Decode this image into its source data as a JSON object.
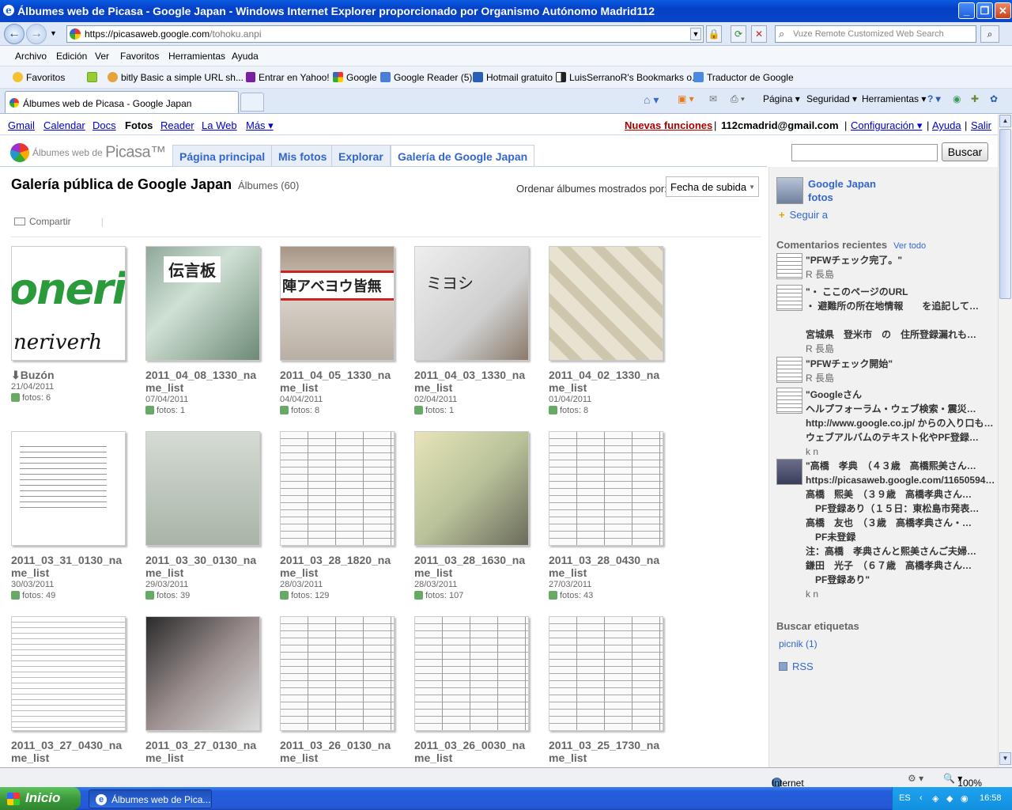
{
  "window": {
    "title": "Álbumes web de Picasa - Google Japan - Windows Internet Explorer proporcionado por Organismo Autónomo Madrid112"
  },
  "address": {
    "url_prefix": "https://",
    "url_domain": "picasaweb.google.com",
    "url_path": "/tohoku.anpi",
    "search_placeholder": "Vuze Remote Customized Web Search"
  },
  "menu": [
    "Archivo",
    "Edición",
    "Ver",
    "Favoritos",
    "Herramientas",
    "Ayuda"
  ],
  "favorites": {
    "label": "Favoritos",
    "items": [
      "bitly  Basic  a simple URL sh...",
      "Entrar en Yahoo!",
      "Google",
      "Google Reader (5)",
      "Hotmail gratuito",
      "LuisSerranoR's Bookmarks o...",
      "Traductor de Google"
    ]
  },
  "tab": {
    "title": "Álbumes web de Picasa - Google Japan"
  },
  "commandbar": [
    "Página",
    "Seguridad",
    "Herramientas"
  ],
  "gbar": {
    "left": [
      "Gmail",
      "Calendar",
      "Docs",
      "Fotos",
      "Reader",
      "La Web",
      "Más ▾"
    ],
    "new_features": "Nuevas funciones",
    "email": "112cmadrid@gmail.com",
    "settings": "Configuración ▾",
    "help": "Ayuda",
    "logout": "Salir"
  },
  "picasa": {
    "logo_small": "Álbumes web de",
    "logo_big": "Picasa™",
    "tabs": [
      "Página principal",
      "Mis fotos",
      "Explorar",
      "Galería de Google Japan"
    ],
    "search_button": "Buscar"
  },
  "gallery": {
    "title": "Galería pública de Google Japan",
    "count": "Álbumes (60)",
    "sort_label": "Ordenar álbumes mostrados por:",
    "sort_value": "Fecha de subida",
    "share": "Compartir"
  },
  "albums": [
    {
      "name": "⬇Buzón",
      "date": "21/04/2011",
      "photos": "fotos: 6"
    },
    {
      "name": "2011_04_08_1330_name_list",
      "date": "07/04/2011",
      "photos": "fotos: 1"
    },
    {
      "name": "2011_04_05_1330_name_list",
      "date": "04/04/2011",
      "photos": "fotos: 8"
    },
    {
      "name": "2011_04_03_1330_name_list",
      "date": "02/04/2011",
      "photos": "fotos: 1"
    },
    {
      "name": "2011_04_02_1330_name_list",
      "date": "01/04/2011",
      "photos": "fotos: 8"
    },
    {
      "name": "2011_03_31_0130_name_list",
      "date": "30/03/2011",
      "photos": "fotos: 49"
    },
    {
      "name": "2011_03_30_0130_name_list",
      "date": "29/03/2011",
      "photos": "fotos: 39"
    },
    {
      "name": "2011_03_28_1820_name_list",
      "date": "28/03/2011",
      "photos": "fotos: 129"
    },
    {
      "name": "2011_03_28_1630_name_list",
      "date": "28/03/2011",
      "photos": "fotos: 107"
    },
    {
      "name": "2011_03_28_0430_name_list",
      "date": "27/03/2011",
      "photos": "fotos: 43"
    },
    {
      "name": "2011_03_27_0430_name_list",
      "date": "",
      "photos": ""
    },
    {
      "name": "2011_03_27_0130_name_list",
      "date": "",
      "photos": ""
    },
    {
      "name": "2011_03_26_0130_name_list",
      "date": "",
      "photos": ""
    },
    {
      "name": "2011_03_26_0030_name_list",
      "date": "",
      "photos": ""
    },
    {
      "name": "2011_03_25_1730_name_list",
      "date": "",
      "photos": ""
    }
  ],
  "thumb_text": {
    "logo_top": "oneri",
    "logo_bottom": "neriverh",
    "t1": "伝言板",
    "t2": "陣アベヨウ皆無",
    "t3": "ミヨシ"
  },
  "sidebar": {
    "owner_name": "Google Japan",
    "owner_sub": "fotos",
    "follow": "Seguir a",
    "recent_comments": "Comentarios recientes",
    "see_all": "Ver todo",
    "comments": [
      {
        "lines": [
          "\"PFWチェック完了。\""
        ],
        "author": "R 長島"
      },
      {
        "lines": [
          "\"・ ここのページのURL",
          "・ 避難所の所在地情報　　を追記して…",
          "",
          "宮城県　登米市　の　住所登録漏れも…"
        ],
        "author": "R 長島"
      },
      {
        "lines": [
          "\"PFWチェック開始\""
        ],
        "author": "R 長島"
      },
      {
        "lines": [
          "\"Googleさん",
          "ヘルプフォーラム・ウェブ検索・震災…",
          "http://www.google.co.jp/ からの入り口も…",
          "ウェブアルバムのテキスト化やPF登録…"
        ],
        "author": "k n"
      },
      {
        "lines": [
          "\"高橋　孝典　（４３歳　高橋熙美さん…",
          "https://picasaweb.google.com/11650594…",
          "高橋　熙美　（３９歳　高橋孝典さん…",
          "　PF登録あり（１５日：東松島市発表…",
          "高橋　友也　（３歳　高橋孝典さん・…",
          "　PF未登録",
          "注：高橋　孝典さんと熙美さんご夫婦…",
          "鎌田　光子　（６７歳　高橋孝典さん…",
          "　PF登録あり\""
        ],
        "author": "k n"
      }
    ],
    "tags_heading": "Buscar etiquetas",
    "tag": "picnik (1)",
    "rss": "RSS"
  },
  "status": {
    "zone": "Internet",
    "zoom": "100%"
  },
  "taskbar": {
    "start": "Inicio",
    "task": "Álbumes web de Pica...",
    "lang": "ES",
    "time": "16:58"
  }
}
